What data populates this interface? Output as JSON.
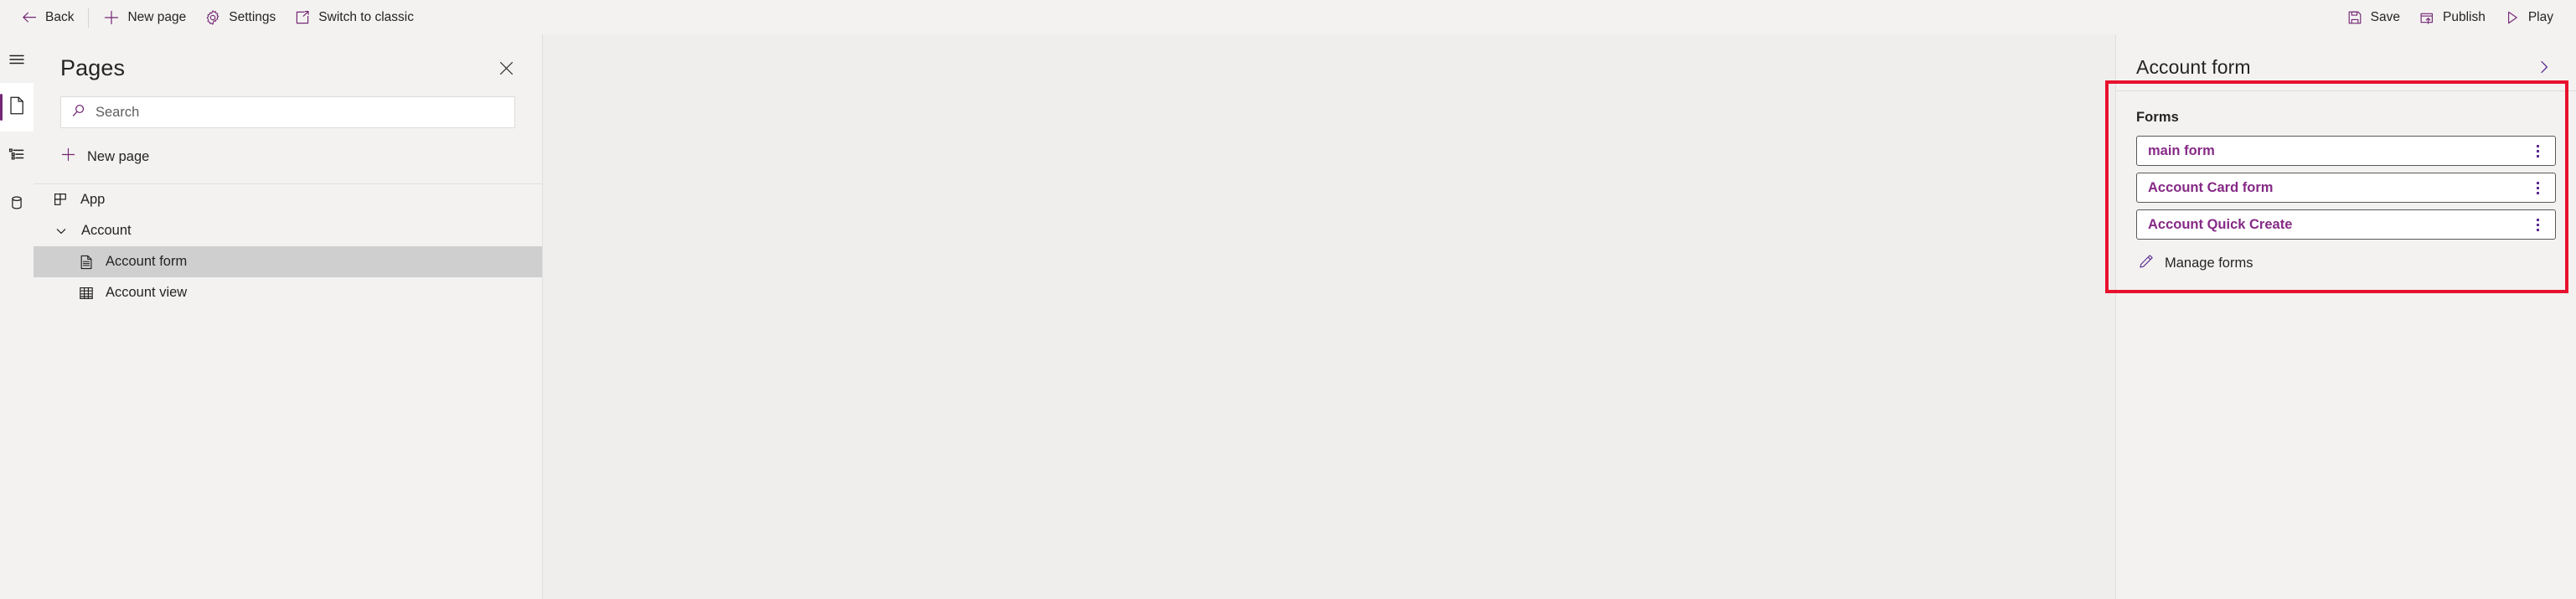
{
  "toolbar": {
    "left_items": [
      {
        "id": "back",
        "label": "Back",
        "icon": "arrow-left-icon"
      },
      {
        "id": "new-page",
        "label": "New page",
        "icon": "plus-icon"
      },
      {
        "id": "settings",
        "label": "Settings",
        "icon": "gear-icon"
      },
      {
        "id": "switch-to-classic",
        "label": "Switch to classic",
        "icon": "open-in-new-icon"
      }
    ],
    "right_items": [
      {
        "id": "save",
        "label": "Save",
        "icon": "save-icon"
      },
      {
        "id": "publish",
        "label": "Publish",
        "icon": "publish-icon"
      },
      {
        "id": "play",
        "label": "Play",
        "icon": "play-icon"
      }
    ]
  },
  "rail": {
    "items": [
      {
        "id": "menu",
        "icon": "hamburger-menu-icon",
        "selected": false
      },
      {
        "id": "pages",
        "icon": "page-icon",
        "selected": true
      },
      {
        "id": "navigation",
        "icon": "list-view-icon",
        "selected": false
      },
      {
        "id": "data",
        "icon": "database-icon",
        "selected": false
      }
    ]
  },
  "pages_panel": {
    "title": "Pages",
    "close_label": "Close",
    "search": {
      "placeholder": "Search",
      "value": ""
    },
    "new_page_label": "New page",
    "tree": [
      {
        "id": "app",
        "label": "App",
        "icon": "app-grid-icon",
        "level": 0,
        "expandable": false,
        "selected": false
      },
      {
        "id": "account",
        "label": "Account",
        "icon": "chevron-down-icon",
        "level": 0,
        "expandable": true,
        "expanded": true,
        "selected": false
      },
      {
        "id": "account-form",
        "label": "Account form",
        "icon": "form-document-icon",
        "level": 1,
        "expandable": false,
        "selected": true
      },
      {
        "id": "account-view",
        "label": "Account view",
        "icon": "table-grid-icon",
        "level": 1,
        "expandable": false,
        "selected": false
      }
    ]
  },
  "properties_panel": {
    "title": "Account form",
    "expand_label": "Expand",
    "forms_section": {
      "label": "Forms",
      "items": [
        {
          "id": "main-form",
          "name": "main form"
        },
        {
          "id": "account-card-form",
          "name": "Account Card form"
        },
        {
          "id": "account-quick-create",
          "name": "Account Quick Create"
        }
      ],
      "manage_label": "Manage forms",
      "manage_icon": "pencil-icon"
    }
  },
  "colors": {
    "accent": "#742774",
    "link": "#862a86",
    "annotation": "#e8112d",
    "chrome": "#f3f2f1",
    "canvas": "#efeeed",
    "selected_row": "#cfcfcf"
  }
}
